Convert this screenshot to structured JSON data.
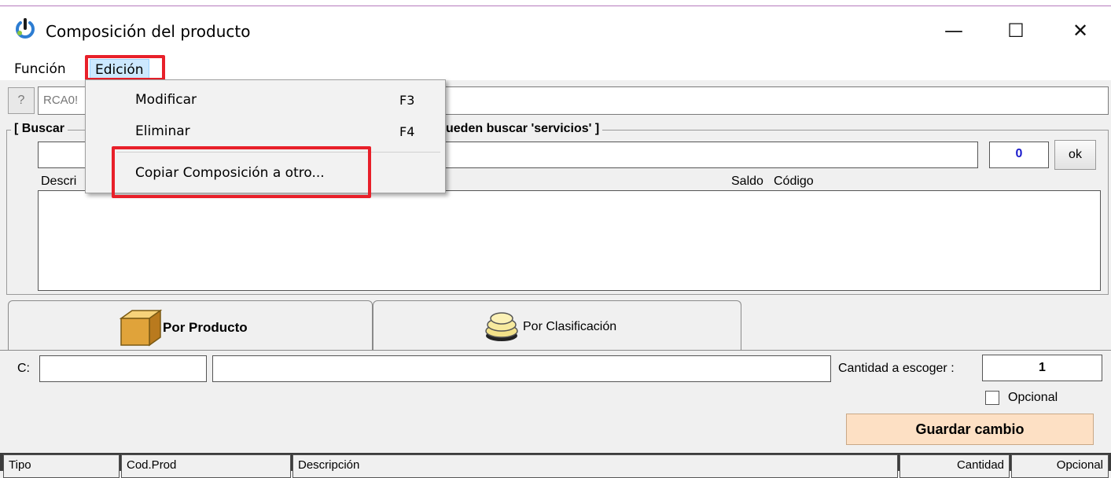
{
  "window": {
    "title": "Composición del producto",
    "controls": {
      "minimize": "—",
      "maximize": "☐",
      "close": "✕"
    }
  },
  "menu": [
    {
      "label": "Función"
    },
    {
      "label": "Edición",
      "active": true
    }
  ],
  "dropdown": {
    "items": [
      {
        "label": "Modificar",
        "shortcut": "F3"
      },
      {
        "label": "Eliminar",
        "shortcut": "F4"
      },
      {
        "label": "Copiar Composición a otro..."
      }
    ]
  },
  "header": {
    "help_label": "?",
    "code_value": "RCA0!"
  },
  "search": {
    "title_left": "[ Buscar",
    "title_right": "ueden buscar 'servicios' ]",
    "count": "0",
    "ok_label": "ok",
    "columns": {
      "description": "Descri",
      "balance": "Saldo",
      "code": "Código"
    }
  },
  "tabs": [
    {
      "label": "Por Producto",
      "active": true
    },
    {
      "label": "Por Clasificación",
      "active": false
    }
  ],
  "form": {
    "c_label": "C:",
    "quantity_label": "Cantidad a escoger :",
    "quantity_value": "1",
    "optional_label": "Opcional",
    "save_label": "Guardar cambio"
  },
  "grid_columns": [
    "Tipo",
    "Cod.Prod",
    "Descripción",
    "Cantidad",
    "Opcional"
  ],
  "colors": {
    "highlight": "#e8202a",
    "menu_active": "#cce8ff",
    "save_button": "#fde0c4",
    "count_text": "#1a1acc"
  }
}
